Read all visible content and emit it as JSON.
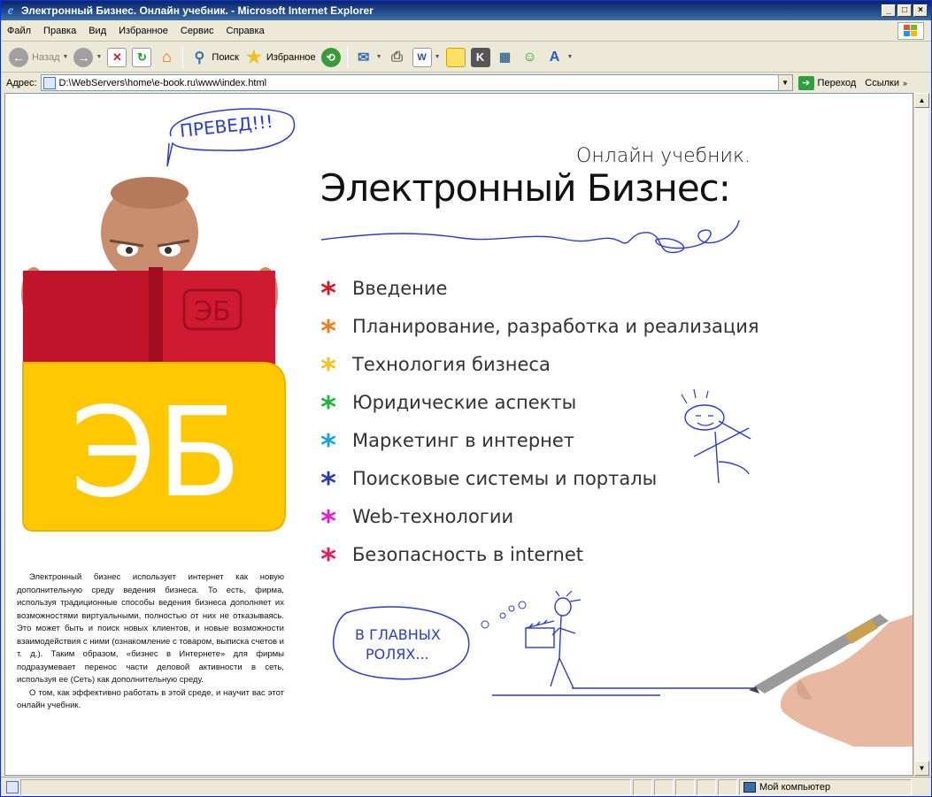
{
  "window": {
    "title": "Электронный Бизнес. Онлайн учебник. - Microsoft Internet Explorer"
  },
  "menubar": {
    "items": [
      "Файл",
      "Правка",
      "Вид",
      "Избранное",
      "Сервис",
      "Справка"
    ]
  },
  "toolbar": {
    "back": "Назад",
    "search": "Поиск",
    "favorites": "Избранное"
  },
  "addressbar": {
    "label": "Адрес:",
    "url": "D:\\WebServers\\home\\e-book.ru\\www\\index.html",
    "go": "Переход",
    "links": "Ссылки"
  },
  "page": {
    "speech_bubble": "ПРЕВЕД!!!",
    "subtitle": "Онлайн учебник.",
    "heading": "Электронный Бизнес:",
    "logo": "ЭБ",
    "book_logo": "ЭБ",
    "menu": [
      {
        "label": "Введение",
        "color": "#d7172c"
      },
      {
        "label": "Планирование, разработка и реализация",
        "color": "#f07c18"
      },
      {
        "label": "Технология бизнеса",
        "color": "#f2c31b"
      },
      {
        "label": "Юридические аспекты",
        "color": "#1fb43a"
      },
      {
        "label": "Маркетинг в интернет",
        "color": "#1aa2e3"
      },
      {
        "label": "Поисковые системы и порталы",
        "color": "#2a3bb8"
      },
      {
        "label": "Web-технологии",
        "color": "#e61bd6"
      },
      {
        "label": "Безопасность в internet",
        "color": "#e8195f"
      }
    ],
    "roles_bubble_line1": "В ГЛАВНЫХ",
    "roles_bubble_line2": "РОЛЯХ...",
    "paragraph1": "Электронный бизнес использует интернет как новую дополнительную среду ведения бизнеса. То есть, фирма, используя традиционные способы ведения бизнеса дополняет их возможностями виртуальными, полностью от них не отказываясь. Это может быть и поиск новых клиентов, и новые возможности взаимодействия с ними (ознакомление с товаром, выписка счетов и т. д.). Таким образом, «бизнес в Интернете» для фирмы подразумевает перенос части деловой активности в сеть, используя ее (Сеть) как дополнительную среду.",
    "paragraph2": "О том, как эффективно работать в этой среде, и научит вас этот онлайн учебник."
  },
  "statusbar": {
    "zone": "Мой компьютер"
  }
}
